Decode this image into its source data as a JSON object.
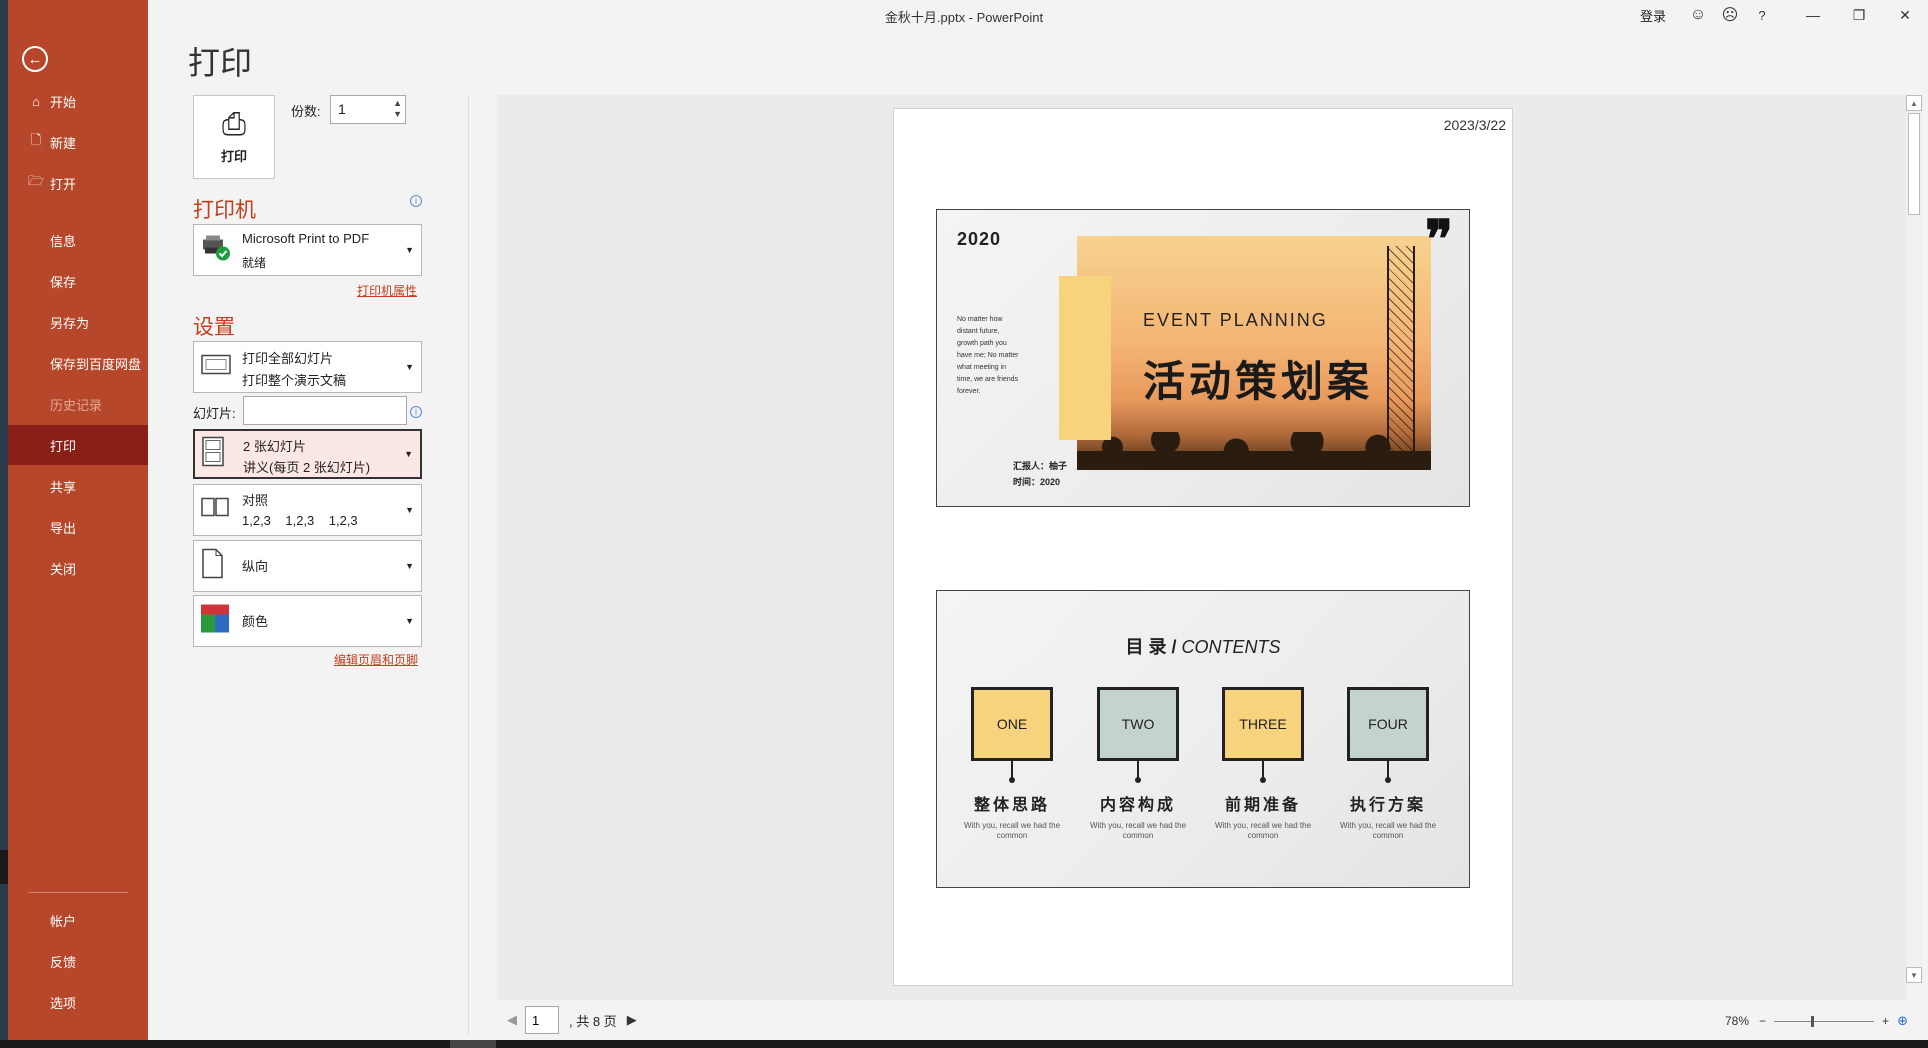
{
  "window": {
    "title": "金秋十月.pptx  -  PowerPoint",
    "login": "登录",
    "help": "?",
    "minimize": "—",
    "restore": "❐",
    "close": "✕"
  },
  "sidebar": {
    "back_icon": "arrow-left-icon",
    "items": [
      {
        "label": "开始",
        "icon": "⌂"
      },
      {
        "label": "新建",
        "icon": "🗋"
      },
      {
        "label": "打开",
        "icon": "🗁"
      },
      {
        "label": "信息"
      },
      {
        "label": "保存"
      },
      {
        "label": "另存为"
      },
      {
        "label": "保存到百度网盘"
      },
      {
        "label": "历史记录"
      },
      {
        "label": "打印"
      },
      {
        "label": "共享"
      },
      {
        "label": "导出"
      },
      {
        "label": "关闭"
      },
      {
        "label": "帐户"
      },
      {
        "label": "反馈"
      },
      {
        "label": "选项"
      }
    ]
  },
  "print": {
    "title": "打印",
    "button_label": "打印",
    "copies_label": "份数:",
    "copies_value": "1",
    "printer_heading": "打印机",
    "printer_name": "Microsoft Print to PDF",
    "printer_status": "就绪",
    "printer_properties_link": "打印机属性",
    "settings_heading": "设置",
    "range_line1": "打印全部幻灯片",
    "range_line2": "打印整个演示文稿",
    "slides_label": "幻灯片:",
    "slides_value": "",
    "layout_line1": "2 张幻灯片",
    "layout_line2": "讲义(每页 2 张幻灯片)",
    "collate_line1": "对照",
    "collate_line2": "1,2,3    1,2,3    1,2,3",
    "orientation": "纵向",
    "color": "颜色",
    "header_footer_link": "编辑页眉和页脚"
  },
  "preview": {
    "page_date": "2023/3/22",
    "slide1": {
      "year": "2020",
      "quote": "❞",
      "event_title": "EVENT PLANNING",
      "cn_title": "活动策划案",
      "blurb": "No matter how distant future, growth path you have me; No matter what meeting in time, we are friends forever.",
      "reporter": "汇报人：柚子",
      "time": "时间：2020"
    },
    "slide2": {
      "title_cn": "目 录 / ",
      "title_en": "CONTENTS",
      "items": [
        {
          "label": "ONE",
          "cn": "整体思路",
          "sub": "With you, recall we had the common"
        },
        {
          "label": "TWO",
          "cn": "内容构成",
          "sub": "With you, recall we had the common"
        },
        {
          "label": "THREE",
          "cn": "前期准备",
          "sub": "With you, recall we had the common"
        },
        {
          "label": "FOUR",
          "cn": "执行方案",
          "sub": "With you, recall we had the common"
        }
      ]
    }
  },
  "pager": {
    "current_page": "1",
    "total_text": ", 共 8 页"
  },
  "zoom": {
    "percent": "78%",
    "minus": "−",
    "plus": "+",
    "level_fraction": 0.37
  },
  "colors": {
    "sidebar_bg": "#b7472a",
    "sidebar_selected": "#8a1f18",
    "accent": "#c43e1c",
    "slide_yellow": "#f6d37c",
    "slide_green": "#c5d3cf"
  }
}
